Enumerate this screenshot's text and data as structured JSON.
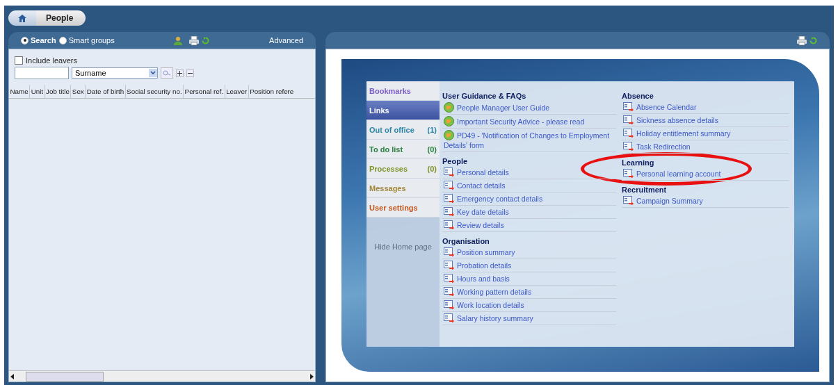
{
  "breadcrumb": {
    "label": "People"
  },
  "left_panel": {
    "modes": [
      {
        "label": "Search",
        "selected": true
      },
      {
        "label": "Smart groups",
        "selected": false
      }
    ],
    "advanced": "Advanced",
    "include_leavers": {
      "label": "Include leavers",
      "checked": false
    },
    "search_by": {
      "value": "Surname"
    },
    "columns": [
      "Name",
      "Unit",
      "Job title",
      "Sex",
      "Date of birth",
      "Social security no.",
      "Personal ref.",
      "Leaver",
      "Position refere"
    ]
  },
  "right_panel": {
    "nav": [
      {
        "label": "Bookmarks",
        "color": "#7a5cc4",
        "selected": false
      },
      {
        "label": "Links",
        "selected": true
      },
      {
        "label": "Out of office",
        "count": "(1)",
        "color": "#2a86a6",
        "selected": false
      },
      {
        "label": "To do list",
        "count": "(0)",
        "color": "#2a8040",
        "selected": false
      },
      {
        "label": "Processes",
        "count": "(0)",
        "color": "#7e9428",
        "selected": false
      },
      {
        "label": "Messages",
        "color": "#a08638",
        "selected": false
      },
      {
        "label": "User settings",
        "color": "#c0561e",
        "selected": false
      }
    ],
    "hide_link": "Hide Home page",
    "link_columns": [
      [
        {
          "title": "User Guidance & FAQs",
          "links": [
            {
              "label": "People Manager User Guide",
              "kind": "globe"
            },
            {
              "label": "Important Security Advice - please read",
              "kind": "globe"
            },
            {
              "label": "PD49 - 'Notification of Changes to Employment Details' form",
              "kind": "globe"
            }
          ]
        },
        {
          "title": "People",
          "links": [
            {
              "label": "Personal details",
              "kind": "form"
            },
            {
              "label": "Contact details",
              "kind": "form"
            },
            {
              "label": "Emergency contact details",
              "kind": "form"
            },
            {
              "label": "Key date details",
              "kind": "form"
            },
            {
              "label": "Review details",
              "kind": "form"
            }
          ]
        },
        {
          "title": "Organisation",
          "links": [
            {
              "label": "Position summary",
              "kind": "form"
            },
            {
              "label": "Probation details",
              "kind": "form"
            },
            {
              "label": "Hours and basis",
              "kind": "form"
            },
            {
              "label": "Working pattern details",
              "kind": "form"
            },
            {
              "label": "Work location details",
              "kind": "form"
            },
            {
              "label": "Salary history summary",
              "kind": "form"
            }
          ]
        }
      ],
      [
        {
          "title": "Absence",
          "links": [
            {
              "label": "Absence Calendar",
              "kind": "form"
            },
            {
              "label": "Sickness absence details",
              "kind": "form"
            },
            {
              "label": "Holiday entitlement summary",
              "kind": "form"
            },
            {
              "label": "Task Redirection",
              "kind": "form"
            }
          ]
        },
        {
          "title": "Learning",
          "links": [
            {
              "label": "Personal learning account",
              "kind": "form"
            }
          ]
        },
        {
          "title": "Recruitment",
          "links": [
            {
              "label": "Campaign Summary",
              "kind": "form"
            }
          ]
        }
      ]
    ]
  },
  "annotation": {
    "kind": "ellipse"
  }
}
